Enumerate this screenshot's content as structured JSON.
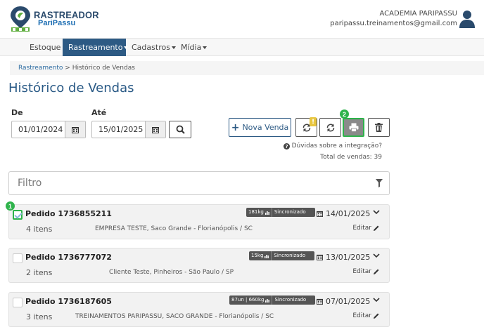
{
  "brand": {
    "title": "RASTREADOR",
    "subtitle": "PariPassu"
  },
  "user": {
    "org": "ACADEMIA PARIPASSU",
    "email": "paripassu.treinamentos@gmail.com"
  },
  "nav": {
    "items": [
      {
        "label": "Estoque",
        "dropdown": false,
        "active": false
      },
      {
        "label": "Rastreamento",
        "dropdown": true,
        "active": true
      },
      {
        "label": "Cadastros",
        "dropdown": true,
        "active": false
      },
      {
        "label": "Mídia",
        "dropdown": true,
        "active": false
      }
    ]
  },
  "breadcrumb": {
    "parent": "Rastreamento",
    "separator": ">",
    "current": "Histórico de Vendas"
  },
  "page": {
    "title": "Histórico de Vendas"
  },
  "filters": {
    "from_label": "De",
    "from_value": "01/01/2024",
    "to_label": "Até",
    "to_value": "15/01/2025"
  },
  "actions": {
    "new_sale": "Nova Venda",
    "help": "Dúvidas sobre a integração?",
    "total": "Total de vendas: 39",
    "step1": "1",
    "step2": "2",
    "warning": "!"
  },
  "filter": {
    "placeholder": "Filtro"
  },
  "orders": [
    {
      "title": "Pedido 1736855211",
      "items": "4 itens",
      "client": "EMPRESA TESTE, Saco Grande - Florianópolis / SC",
      "weight": "181kg",
      "status": "Sincronizado",
      "date": "14/01/2025",
      "edit": "Editar",
      "checked": true
    },
    {
      "title": "Pedido 1736777072",
      "items": "2 itens",
      "client": "Cliente Teste, Pinheiros - São Paulo / SP",
      "weight": "15kg",
      "status": "Sincronizado",
      "date": "13/01/2025",
      "edit": "Editar",
      "checked": false
    },
    {
      "title": "Pedido 1736187605",
      "items": "3 itens",
      "client": "TREINAMENTOS PARIPASSU, SACO GRANDE - Florianópolis / SC",
      "weight": "87un | 660kg",
      "status": "Sincronizado",
      "date": "07/01/2025",
      "edit": "Editar",
      "checked": false
    }
  ],
  "colors": {
    "primary": "#2d5a84",
    "accent_green": "#2db34a",
    "title_blue": "#2a5a86",
    "warning": "#e8c640"
  }
}
